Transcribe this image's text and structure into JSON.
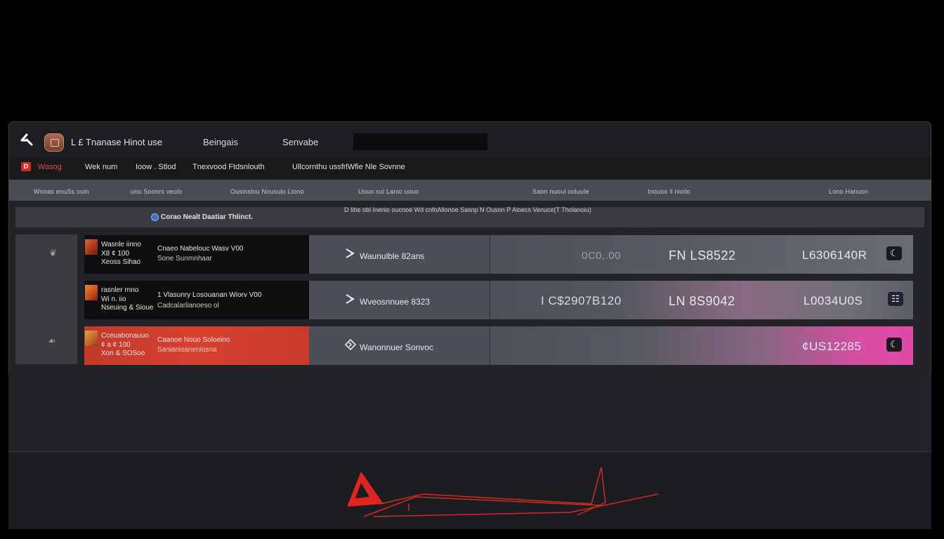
{
  "topbar": {
    "title": "L £ Tnanase Hinot use",
    "nav": [
      "Beingais",
      "Senvabe"
    ],
    "search_value": ""
  },
  "subbar": {
    "badge": "D",
    "items": [
      "Wasog",
      "Wek num",
      "Ioow . Stlod",
      "Tnexvood  Ftdsnlouth",
      "Ullcornthu ussfrlWfie Nle Sovnne"
    ]
  },
  "columns": [
    "Wnoas enuSs ouin",
    "unu Soonrs veulo",
    "Ousinslou Nousulo Liono",
    "Uouo sul  Lanio uouo",
    "Saon nuoul ooluule",
    "Inouoo ll nioilo",
    "Lono Hanuon"
  ],
  "section": {
    "title": "Corao Nealt Daatiar Thlinct.",
    "description": "D Iibe obl  Inenio  oucnoe Wd cnfoAllonoe Sasnp N Ouson  P Aloecs Venuce(T Tholanoiu)"
  },
  "rail": [
    "❦",
    "☙"
  ],
  "rows": [
    {
      "a_lines": [
        "Wasnle iinno",
        "X8 ¢ 100",
        "Xeoss Sihao"
      ],
      "a_meta": [
        "Cnaeo Nabelouc  Wasv V00",
        "Sone Sunmnhaar"
      ],
      "b_text": "Waunulble 82ans",
      "c_v1": "0C0,.00",
      "c_v2": "FN  LS8522",
      "c_v3": "L6306140R",
      "icon": "☾"
    },
    {
      "a_lines": [
        "rasnler rnno",
        "Wi n.  iio",
        "Nseuing & Sioue"
      ],
      "a_meta": [
        "1 Vlasunry Losouanan   Wiorv V00",
        "Cadcalarlianoeso ol"
      ],
      "b_text": "Wveosnnuee 8323",
      "c_v1": "I C$2907B120",
      "c_v2": "LN  8S9042",
      "c_v3": "L0034U0S",
      "icon": "☷"
    },
    {
      "a_lines": [
        "Cceuabonauuo",
        "¢ a  ¢ 100",
        "Xon & SOSoo"
      ],
      "a_meta": [
        "Caanoe Nouo Soloeino",
        "Sanianisaneniosna"
      ],
      "b_text": "Wanonnuer Sonvoc",
      "c_v1": "",
      "c_v2": "",
      "c_v3": "¢US12285",
      "icon": "☾"
    }
  ],
  "colors": {
    "accent_red": "#d22a2a",
    "pink_highlight": "#e0479a",
    "window_bg": "#222327",
    "header_bar": "#4a4c53"
  },
  "lower_pane": {
    "icon": "warning-triangle-icon"
  }
}
